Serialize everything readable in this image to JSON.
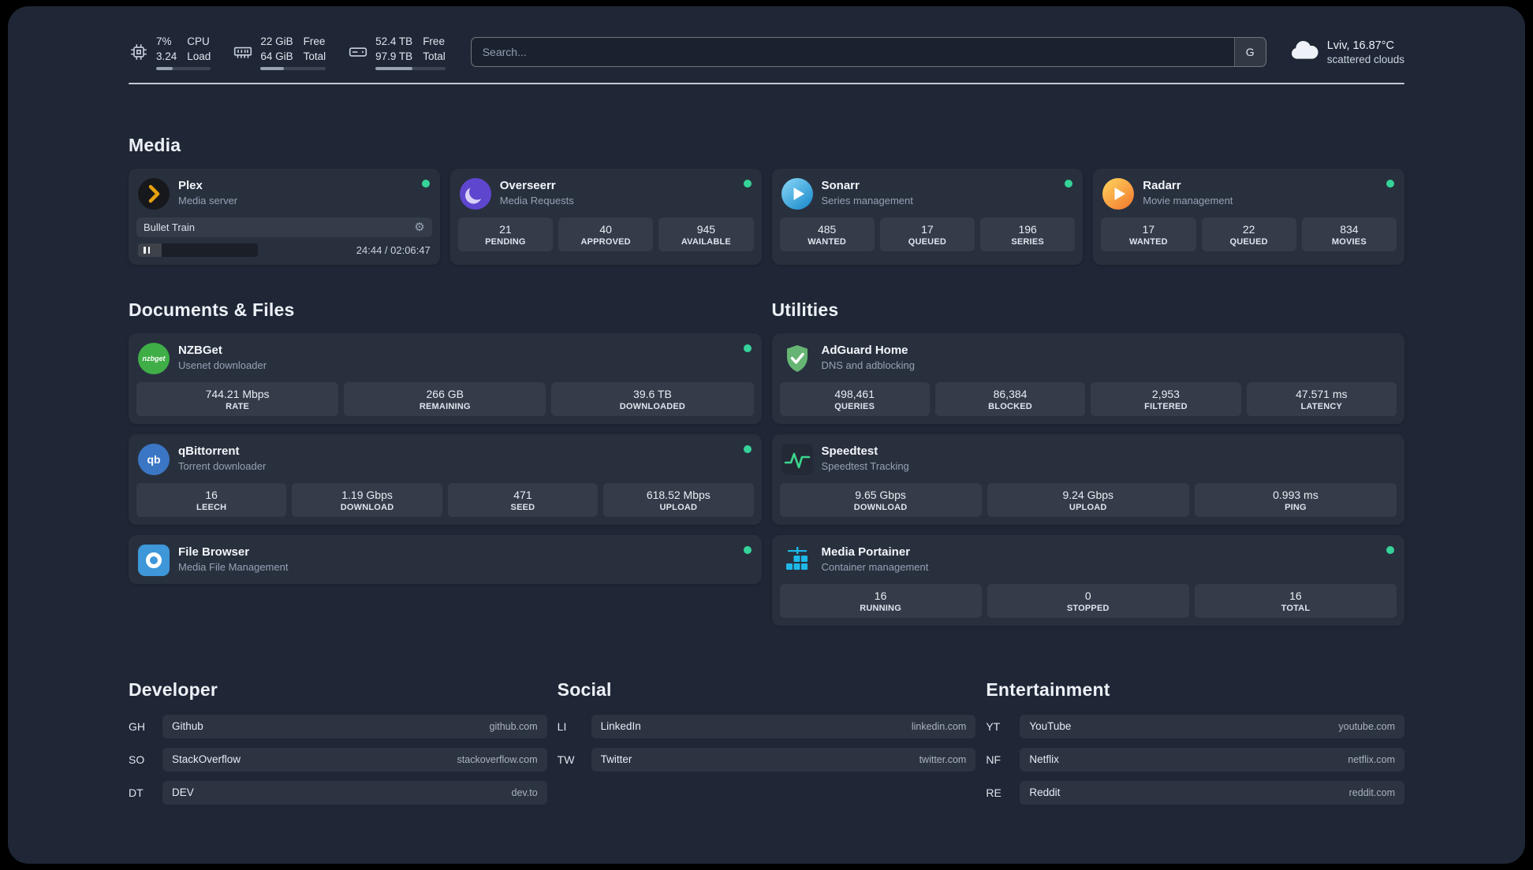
{
  "topbar": {
    "cpu": {
      "value_top": "7%",
      "value_bottom": "3.24",
      "label_top": "CPU",
      "label_bottom": "Load",
      "bar_percent": 30
    },
    "memory": {
      "value_top": "22 GiB",
      "value_bottom": "64 GiB",
      "label_top": "Free",
      "label_bottom": "Total",
      "bar_percent": 36
    },
    "disk": {
      "value_top": "52.4 TB",
      "value_bottom": "97.9 TB",
      "label_top": "Free",
      "label_bottom": "Total",
      "bar_percent": 53
    },
    "search": {
      "placeholder": "Search...",
      "button_label": "G"
    },
    "weather": {
      "location": "Lviv, 16.87°C",
      "condition": "scattered clouds"
    }
  },
  "media": {
    "title": "Media",
    "cards": [
      {
        "name": "Plex",
        "subtitle": "Media server",
        "status": "online",
        "player": {
          "title": "Bullet Train",
          "time": "24:44 / 02:06:47",
          "progress_percent": 19.6
        }
      },
      {
        "name": "Overseerr",
        "subtitle": "Media Requests",
        "status": "online",
        "stats": [
          {
            "value": "21",
            "label": "PENDING"
          },
          {
            "value": "40",
            "label": "APPROVED"
          },
          {
            "value": "945",
            "label": "AVAILABLE"
          }
        ]
      },
      {
        "name": "Sonarr",
        "subtitle": "Series management",
        "status": "online",
        "stats": [
          {
            "value": "485",
            "label": "WANTED"
          },
          {
            "value": "17",
            "label": "QUEUED"
          },
          {
            "value": "196",
            "label": "SERIES"
          }
        ]
      },
      {
        "name": "Radarr",
        "subtitle": "Movie management",
        "status": "online",
        "stats": [
          {
            "value": "17",
            "label": "WANTED"
          },
          {
            "value": "22",
            "label": "QUEUED"
          },
          {
            "value": "834",
            "label": "MOVIES"
          }
        ]
      }
    ]
  },
  "documents": {
    "title": "Documents & Files",
    "cards": [
      {
        "name": "NZBGet",
        "subtitle": "Usenet downloader",
        "status": "online",
        "icon_text": "nzbget",
        "stats": [
          {
            "value": "744.21 Mbps",
            "label": "RATE"
          },
          {
            "value": "266 GB",
            "label": "REMAINING"
          },
          {
            "value": "39.6 TB",
            "label": "DOWNLOADED"
          }
        ]
      },
      {
        "name": "qBittorrent",
        "subtitle": "Torrent downloader",
        "status": "online",
        "icon_text": "qb",
        "stats": [
          {
            "value": "16",
            "label": "LEECH"
          },
          {
            "value": "1.19 Gbps",
            "label": "DOWNLOAD"
          },
          {
            "value": "471",
            "label": "SEED"
          },
          {
            "value": "618.52 Mbps",
            "label": "UPLOAD"
          }
        ]
      },
      {
        "name": "File Browser",
        "subtitle": "Media File Management",
        "status": "online"
      }
    ]
  },
  "utilities": {
    "title": "Utilities",
    "cards": [
      {
        "name": "AdGuard Home",
        "subtitle": "DNS and adblocking",
        "stats": [
          {
            "value": "498,461",
            "label": "QUERIES"
          },
          {
            "value": "86,384",
            "label": "BLOCKED"
          },
          {
            "value": "2,953",
            "label": "FILTERED"
          },
          {
            "value": "47.571 ms",
            "label": "LATENCY"
          }
        ]
      },
      {
        "name": "Speedtest",
        "subtitle": "Speedtest Tracking",
        "stats": [
          {
            "value": "9.65 Gbps",
            "label": "DOWNLOAD"
          },
          {
            "value": "9.24 Gbps",
            "label": "UPLOAD"
          },
          {
            "value": "0.993 ms",
            "label": "PING"
          }
        ]
      },
      {
        "name": "Media Portainer",
        "subtitle": "Container management",
        "status": "online",
        "stats": [
          {
            "value": "16",
            "label": "RUNNING"
          },
          {
            "value": "0",
            "label": "STOPPED"
          },
          {
            "value": "16",
            "label": "TOTAL"
          }
        ]
      }
    ]
  },
  "bookmarks": [
    {
      "title": "Developer",
      "links": [
        {
          "abbr": "GH",
          "name": "Github",
          "domain": "github.com"
        },
        {
          "abbr": "SO",
          "name": "StackOverflow",
          "domain": "stackoverflow.com"
        },
        {
          "abbr": "DT",
          "name": "DEV",
          "domain": "dev.to"
        }
      ]
    },
    {
      "title": "Social",
      "links": [
        {
          "abbr": "LI",
          "name": "LinkedIn",
          "domain": "linkedin.com"
        },
        {
          "abbr": "TW",
          "name": "Twitter",
          "domain": "twitter.com"
        }
      ]
    },
    {
      "title": "Entertainment",
      "links": [
        {
          "abbr": "YT",
          "name": "YouTube",
          "domain": "youtube.com"
        },
        {
          "abbr": "NF",
          "name": "Netflix",
          "domain": "netflix.com"
        },
        {
          "abbr": "RE",
          "name": "Reddit",
          "domain": "reddit.com"
        }
      ]
    }
  ],
  "colors": {
    "status_online": "#35d399",
    "background": "#1f2736"
  }
}
